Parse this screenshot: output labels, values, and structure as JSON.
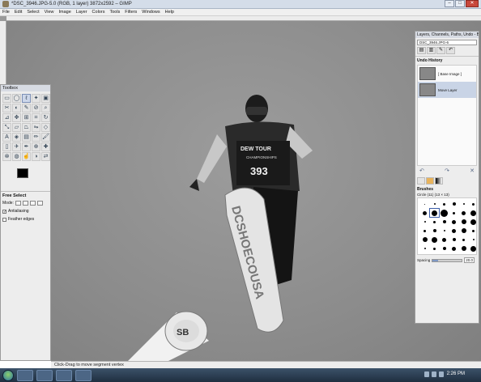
{
  "window": {
    "title": "*DSC_3946.JPG-5.0 (RGB, 1 layer) 3872x2592 – GIMP",
    "buttons": [
      "–",
      "□",
      "✕"
    ]
  },
  "menubar": [
    "File",
    "Edit",
    "Select",
    "View",
    "Image",
    "Layer",
    "Colors",
    "Tools",
    "Filters",
    "Windows",
    "Help"
  ],
  "toolbox": {
    "title": "Toolbox",
    "tool_options_title": "Free Select",
    "mode_label": "Mode:",
    "antialiasing_label": "Antialiasing",
    "feather_label": "Feather edges",
    "antialiasing_checked": true,
    "feather_checked": false
  },
  "dock": {
    "title": "Layers, Channels, Paths, Undo - Br...",
    "image_selector": "DSC_3946.JPG-6",
    "undo_history_title": "Undo History",
    "undo_items": [
      "[ Base Image ]",
      "Move Layer"
    ],
    "brushes_title": "Brushes",
    "brush_name": "Circle (11) (13 × 13)",
    "spacing_label": "Spacing",
    "spacing_value": "20.0",
    "spacing_fraction": 0.2
  },
  "status": {
    "message": "Click-Drag to move segment vertex"
  },
  "taskbar": {
    "clock": "2:26 PM"
  },
  "photo_text": {
    "bib_sponsor": "DEW TOUR",
    "bib_event": "CHAMPIONSHIPS",
    "bib_number": "393",
    "board_text": "DCSHOECOUSA",
    "rail_logo": "SB"
  }
}
